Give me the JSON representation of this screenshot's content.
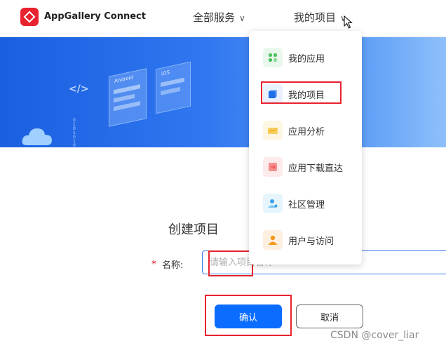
{
  "header": {
    "app_title": "AppGallery Connect",
    "nav_all_services": "全部服务",
    "nav_my_projects": "我的项目"
  },
  "dropdown": {
    "items": [
      {
        "label": "我的应用",
        "icon": "apps-icon",
        "color": "#4cc25a",
        "bg": "#eaf7ec"
      },
      {
        "label": "我的项目",
        "icon": "project-icon",
        "color": "#1f6fe8",
        "bg": "#e8f1fd"
      },
      {
        "label": "应用分析",
        "icon": "analytics-icon",
        "color": "#f2b31c",
        "bg": "#fdf6e3"
      },
      {
        "label": "应用下载直达",
        "icon": "download-icon",
        "color": "#f05a5a",
        "bg": "#fdeaea"
      },
      {
        "label": "社区管理",
        "icon": "community-icon",
        "color": "#3aa3e8",
        "bg": "#e6f4fc"
      },
      {
        "label": "用户与访问",
        "icon": "user-icon",
        "color": "#f59a1c",
        "bg": "#fdf0e0"
      }
    ]
  },
  "banner": {
    "code_symbol": "</>",
    "card1_label": "Android",
    "card2_label": "iOS",
    "binary": "0101010"
  },
  "form": {
    "title": "创建项目",
    "required_mark": "*",
    "name_label": "名称:",
    "name_placeholder": "请输入项目名称",
    "confirm_label": "确认",
    "cancel_label": "取消"
  },
  "watermark": "CSDN @cover_liar",
  "colors": {
    "brand_red": "#e8222e",
    "primary_blue": "#0a6dff",
    "annotation_red": "#e8222e"
  }
}
